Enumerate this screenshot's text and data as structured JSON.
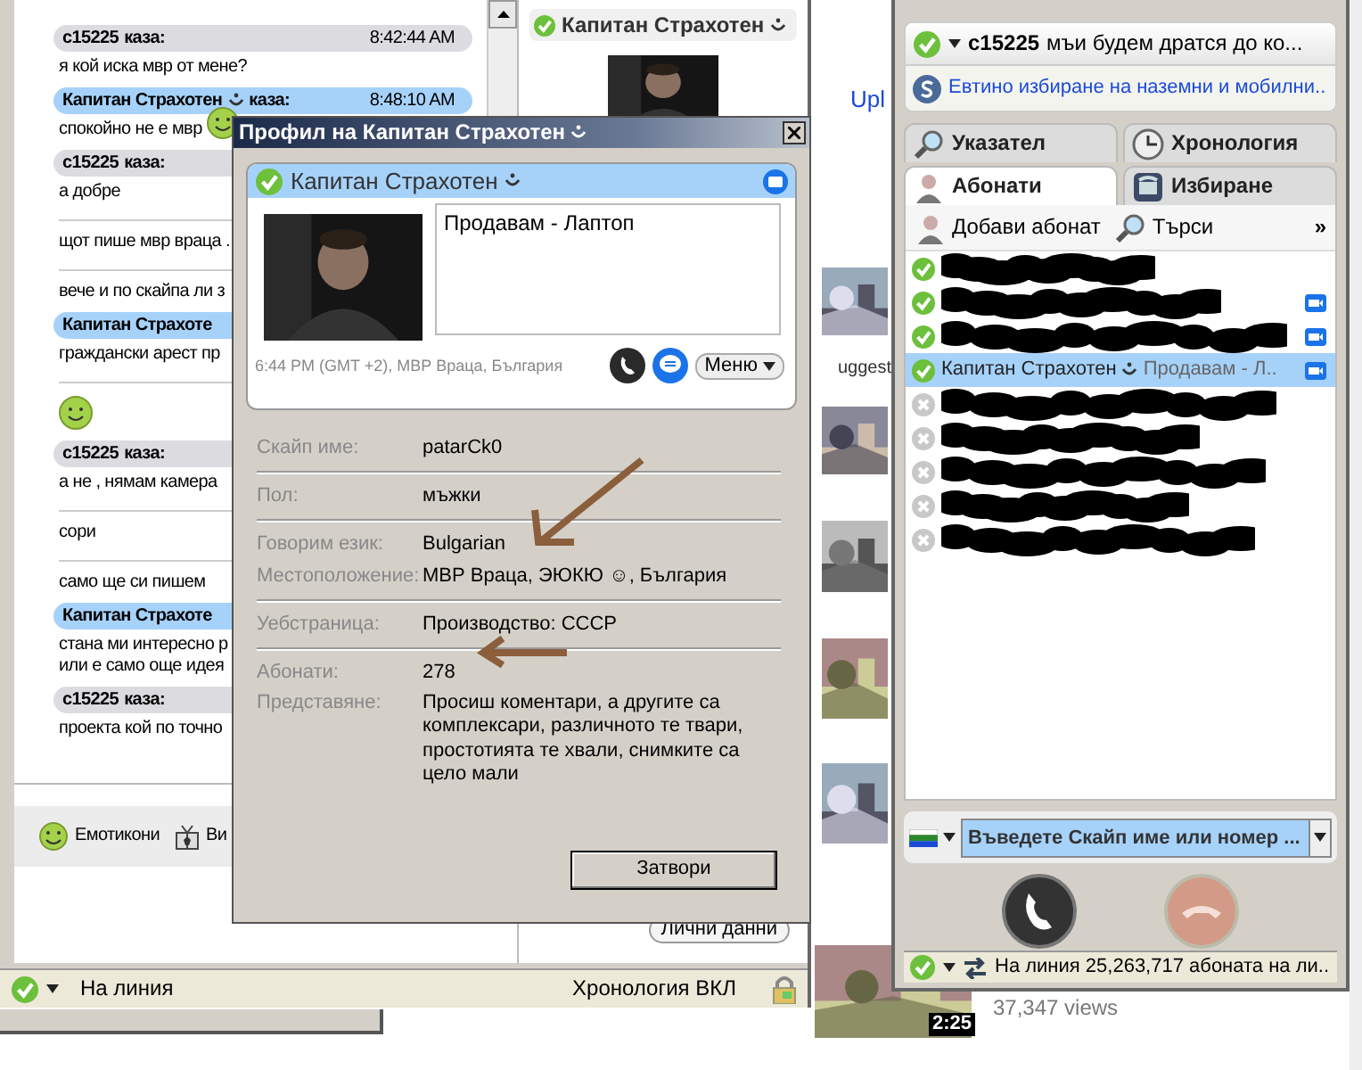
{
  "browser": {
    "link": "Upl",
    "heading": "uggest",
    "duration": "2:25",
    "views": "37,347 views"
  },
  "chat_window": {
    "messages": [
      {
        "kind": "header",
        "sender": "c15225",
        "mood_icon": false,
        "verb": "каза:",
        "time": "8:42:44 AM",
        "color": "#dcdce0"
      },
      {
        "kind": "text",
        "text": "я кой иска мвр от мене?"
      },
      {
        "kind": "header",
        "sender": "Капитан Страхотен",
        "mood_icon": true,
        "verb": "каза:",
        "time": "8:48:10 AM",
        "color": "#a6d2fa"
      },
      {
        "kind": "text",
        "text": "спокойно не е мвр",
        "emoticon": true
      },
      {
        "kind": "header",
        "sender": "c15225",
        "mood_icon": false,
        "verb": "каза:",
        "color": "#dcdce0"
      },
      {
        "kind": "text",
        "text": "а добре"
      },
      {
        "kind": "divider"
      },
      {
        "kind": "text",
        "text": "щот пише мвр враца ."
      },
      {
        "kind": "divider"
      },
      {
        "kind": "text",
        "text": "вече и по скайпа ли з"
      },
      {
        "kind": "header",
        "sender": "Капитан Страхоте",
        "mood_icon": false,
        "color": "#a6d2fa"
      },
      {
        "kind": "text",
        "text": "граждански арест пр"
      },
      {
        "kind": "divider"
      },
      {
        "kind": "emoticon"
      },
      {
        "kind": "header",
        "sender": "c15225",
        "mood_icon": false,
        "verb": "каза:",
        "color": "#dcdce0"
      },
      {
        "kind": "text",
        "text": "а не , нямам камера"
      },
      {
        "kind": "divider"
      },
      {
        "kind": "text",
        "text": "сори"
      },
      {
        "kind": "divider"
      },
      {
        "kind": "text",
        "text": "само ще си пишем"
      },
      {
        "kind": "header",
        "sender": "Капитан Страхоте",
        "mood_icon": false,
        "color": "#a6d2fa"
      },
      {
        "kind": "text",
        "text": "стана ми интересно р\nили е само още идея"
      },
      {
        "kind": "header",
        "sender": "c15225",
        "mood_icon": false,
        "verb": "каза:",
        "color": "#dcdce0"
      },
      {
        "kind": "text",
        "text": "проекта кой по точно"
      }
    ],
    "toolbar": [
      {
        "label": "Емотикони"
      },
      {
        "label": "Ви"
      }
    ],
    "status_bar": {
      "status": "На линия",
      "history": "Хронология ВКЛ"
    }
  },
  "contact_pane": {
    "name": "Капитан Страхотен",
    "button": "Лични данни"
  },
  "profile_dialog": {
    "title": "Профил на Капитан Страхотен",
    "name": "Капитан Страхотен",
    "mood": "Продавам - Лаптоп",
    "local_time": "6:44 PM (GMT +2), МВР Враца, България",
    "menu_button": "Меню",
    "field_groups": [
      [
        {
          "label": "Скайп име:",
          "value": "patarCk0",
          "kind": "text"
        }
      ],
      [
        {
          "label": "Пол:",
          "value": "мъжки",
          "kind": "text"
        }
      ],
      [
        {
          "label": "Говорим език:",
          "value": "Bulgarian",
          "kind": "text"
        },
        {
          "label": "Местоположение:",
          "value": "МВР Враца, ЭЮКЮ ☺, България",
          "kind": "text"
        }
      ],
      [
        {
          "label": "Уебстраница:",
          "value": "Производство: СССР",
          "kind": "link"
        }
      ],
      [
        {
          "label": "Абонати:",
          "value": "278",
          "kind": "text"
        },
        {
          "label": "Представяне:",
          "value": "Просиш коментари, а другите са комплексари, различното те твари, простотията те хвали, снимките са цело мали",
          "kind": "text"
        }
      ]
    ],
    "close_button": "Затвори"
  },
  "skype_window": {
    "user": "c15225",
    "mood": "мъи будем дратся до ко...",
    "promo": "Евтино избиране на наземни и мобилни..",
    "tabs": [
      {
        "label": "Указател",
        "selected": false
      },
      {
        "label": "Хронология",
        "selected": false
      },
      {
        "label": "Абонати",
        "selected": true
      },
      {
        "label": "Избиране",
        "selected": false
      }
    ],
    "toolbar": [
      {
        "label": "Добави абонат"
      },
      {
        "label": "Търси"
      }
    ],
    "more": "»",
    "contacts": [
      {
        "online": true,
        "video": false,
        "redacted": true,
        "selected": false
      },
      {
        "online": true,
        "video": true,
        "redacted": true,
        "selected": false
      },
      {
        "online": true,
        "video": true,
        "redacted": true,
        "selected": false
      },
      {
        "name": "Капитан Страхотен",
        "mood": "Продавам - Л..",
        "online": true,
        "video": true,
        "redacted": false,
        "selected": true
      },
      {
        "online": false,
        "video": false,
        "redacted": true,
        "selected": false
      },
      {
        "online": false,
        "video": false,
        "redacted": true,
        "selected": false
      },
      {
        "online": false,
        "video": false,
        "redacted": true,
        "selected": false
      },
      {
        "online": false,
        "video": false,
        "redacted": true,
        "selected": false
      },
      {
        "online": false,
        "video": false,
        "redacted": true,
        "selected": false
      }
    ],
    "dial_value": "Въведете Скайп име или номер ...",
    "status_bar": "На линия  25,263,717 абоната на ли.."
  }
}
